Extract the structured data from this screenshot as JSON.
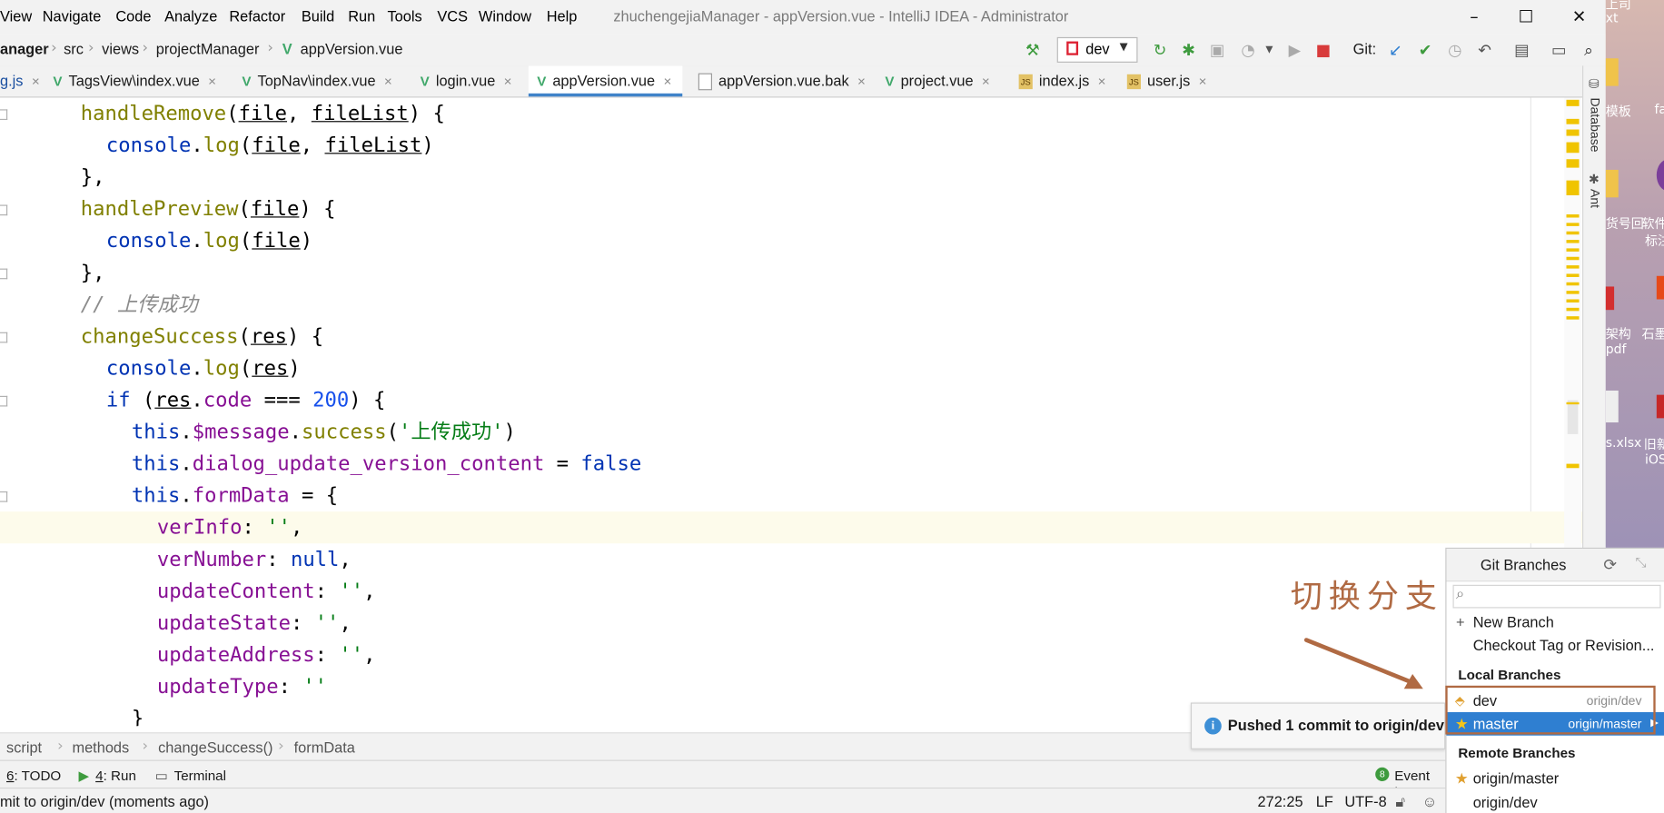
{
  "menubar": {
    "items": [
      "View",
      "Navigate",
      "Code",
      "Analyze",
      "Refactor",
      "Build",
      "Run",
      "Tools",
      "VCS",
      "Window",
      "Help"
    ],
    "window_title": "zhuchengejiaManager - appVersion.vue - IntelliJ IDEA - Administrator",
    "min_glyph": "–",
    "max_glyph": "☐",
    "close_glyph": "✕"
  },
  "navbar": {
    "crumbs": [
      "anager",
      "src",
      "views",
      "projectManager",
      "appVersion.vue"
    ],
    "branch": "dev",
    "git_label": "Git:"
  },
  "tabs": [
    {
      "label": "g.js",
      "kind": "js-partial"
    },
    {
      "label": "TagsView\\index.vue",
      "kind": "vue"
    },
    {
      "label": "TopNav\\index.vue",
      "kind": "vue"
    },
    {
      "label": "login.vue",
      "kind": "vue"
    },
    {
      "label": "appVersion.vue",
      "kind": "vue",
      "active": true
    },
    {
      "label": "appVersion.vue.bak",
      "kind": "bak"
    },
    {
      "label": "project.vue",
      "kind": "vue"
    },
    {
      "label": "index.js",
      "kind": "js"
    },
    {
      "label": "user.js",
      "kind": "js"
    }
  ],
  "tab_close": "×",
  "code": {
    "l1": {
      "name": "handleRemove",
      "p1": "file",
      "comma": ", ",
      "p2": "fileList",
      "tail": ") {"
    },
    "l2": {
      "obj": "console",
      "dot": ".",
      "m": "log",
      "p1": "file",
      "comma": ", ",
      "p2": "fileList"
    },
    "l3": "},",
    "l4": {
      "name": "handlePreview",
      "p1": "file",
      "tail": ") {"
    },
    "l5": {
      "obj": "console",
      "m": "log",
      "p1": "file"
    },
    "l6": "},",
    "l7": "// 上传成功",
    "l8": {
      "name": "changeSuccess",
      "p1": "res",
      "tail": ") {"
    },
    "l9": {
      "obj": "console",
      "m": "log",
      "p1": "res"
    },
    "l10": {
      "kw": "if",
      "p1": "res",
      "prop": "code",
      "op": " === ",
      "num": "200",
      "tail": ") {"
    },
    "l11": {
      "kw": "this",
      "prop": "$message",
      "m": "success",
      "str": "'上传成功'"
    },
    "l12": {
      "kw": "this",
      "prop": "dialog_update_version_content",
      "op": " = ",
      "val": "false"
    },
    "l13": {
      "kw": "this",
      "prop": "formData",
      "op": " = {"
    },
    "l14": {
      "prop": "verInfo",
      "val": "''"
    },
    "l15": {
      "prop": "verNumber",
      "val": "null"
    },
    "l16": {
      "prop": "updateContent",
      "val": "''"
    },
    "l17": {
      "prop": "updateState",
      "val": "''"
    },
    "l18": {
      "prop": "updateAddress",
      "val": "''"
    },
    "l19": {
      "prop": "updateType",
      "val": "''"
    },
    "l20": "}"
  },
  "right_stripe": {
    "database": "Database",
    "ant": "Ant"
  },
  "breadcrumb": [
    "script",
    "methods",
    "changeSuccess()",
    "formData"
  ],
  "toolwindows": {
    "todo_num": "6",
    "todo": ": TODO",
    "run_num": "4",
    "run": ": Run",
    "terminal": "Terminal",
    "event_log": "Event Lo",
    "event_count": "8"
  },
  "statusbar": {
    "message": "mit to origin/dev (moments ago)",
    "position": "272:25",
    "line_sep": "LF",
    "encoding": "UTF-8"
  },
  "notification": "Pushed 1 commit to origin/dev",
  "annotation": "切换分支",
  "git_branches": {
    "title": "Git Branches",
    "new_branch": "New Branch",
    "checkout": "Checkout Tag or Revision...",
    "local_header": "Local Branches",
    "local": [
      {
        "name": "dev",
        "tracking": "origin/dev"
      },
      {
        "name": "master",
        "tracking": "origin/master"
      }
    ],
    "remote_header": "Remote Branches",
    "remote": [
      "origin/master",
      "origin/dev"
    ]
  },
  "desktop": {
    "labels": [
      "上司",
      "xt",
      "模板",
      "fa",
      "货号回",
      "软件",
      "标注",
      "架构",
      "pdf",
      "石墨",
      "s.xlsx",
      "旧新",
      "iOS"
    ]
  },
  "colors": {
    "accent": "#2f7fd1",
    "annotation": "#b06a43",
    "tab_underline": "#4083c9",
    "vue_icon": "#41a86b"
  }
}
